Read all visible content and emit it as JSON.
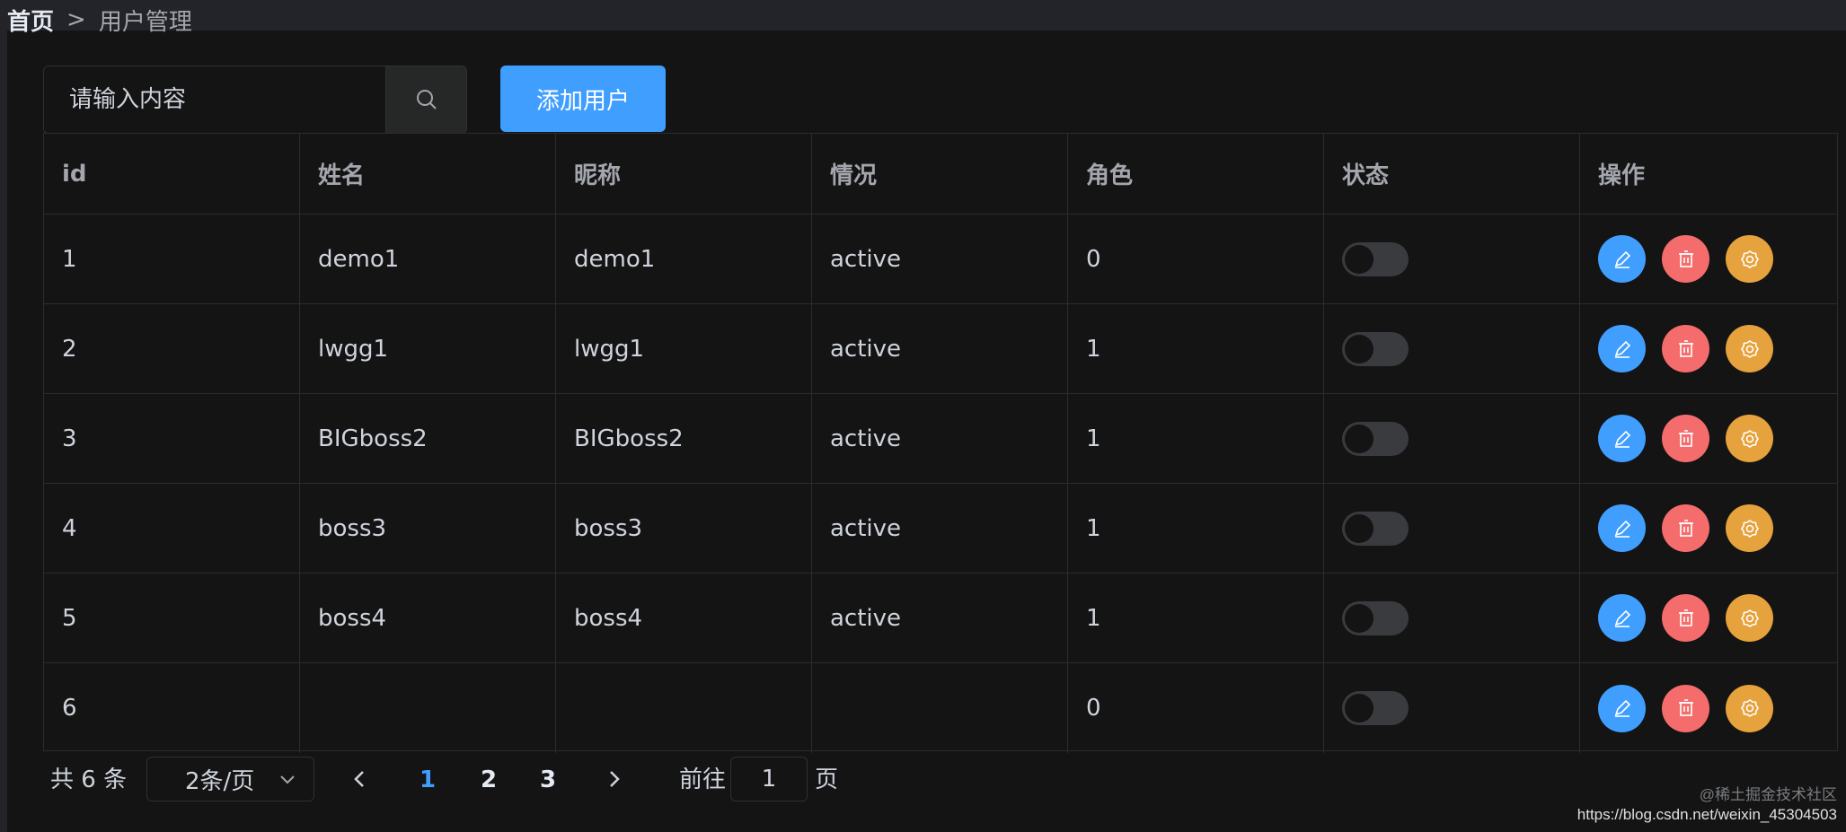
{
  "breadcrumb": {
    "home": "首页",
    "separator": ">",
    "current": "用户管理"
  },
  "search": {
    "placeholder": "请输入内容",
    "icon": "search-icon"
  },
  "toolbar": {
    "add_label": "添加用户"
  },
  "table": {
    "headers": [
      "id",
      "姓名",
      "昵称",
      "情况",
      "角色",
      "状态",
      "操作"
    ],
    "rows": [
      {
        "id": "1",
        "name": "demo1",
        "nickname": "demo1",
        "situation": "active",
        "role": "0",
        "status_on": false
      },
      {
        "id": "2",
        "name": "lwgg1",
        "nickname": "lwgg1",
        "situation": "active",
        "role": "1",
        "status_on": false
      },
      {
        "id": "3",
        "name": "BIGboss2",
        "nickname": "BIGboss2",
        "situation": "active",
        "role": "1",
        "status_on": false
      },
      {
        "id": "4",
        "name": "boss3",
        "nickname": "boss3",
        "situation": "active",
        "role": "1",
        "status_on": false
      },
      {
        "id": "5",
        "name": "boss4",
        "nickname": "boss4",
        "situation": "active",
        "role": "1",
        "status_on": false
      },
      {
        "id": "6",
        "name": "",
        "nickname": "",
        "situation": "",
        "role": "0",
        "status_on": false
      }
    ],
    "action_icons": [
      "edit-icon",
      "delete-icon",
      "settings-icon"
    ]
  },
  "pagination": {
    "total_label": "共 6 条",
    "page_size_label": "2条/页",
    "pages": [
      "1",
      "2",
      "3"
    ],
    "active_page": "1",
    "goto_label": "前往",
    "goto_value": "1",
    "goto_suffix": "页"
  },
  "watermark": {
    "line1": "@稀土掘金技术社区",
    "line2": "https://blog.csdn.net/weixin_45304503"
  },
  "colors": {
    "primary": "#409eff",
    "danger": "#f56c6c",
    "warning": "#e6a23c",
    "background": "#141414"
  }
}
